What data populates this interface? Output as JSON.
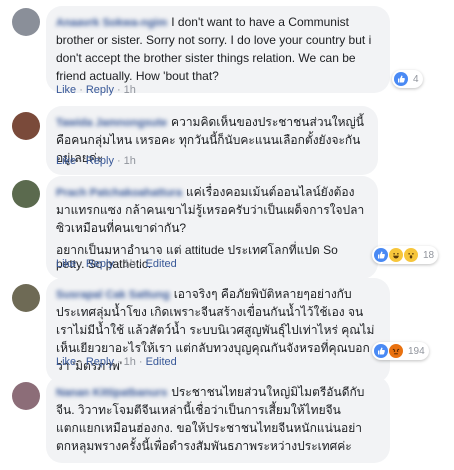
{
  "actions": {
    "like": "Like",
    "reply": "Reply",
    "edited": "Edited"
  },
  "comments": [
    {
      "author": "Anaavrk Sokwa-ngim",
      "text": "I don't want to have a Communist brother or sister. Sorry not sorry. I do love your country but i don't accept the brother sister things relation. We can be friend actually. How 'bout that?",
      "time": "1h",
      "reaction_count": "4",
      "avatar_color": "#8a8f99"
    },
    {
      "author": "Tawida Jamnongsute",
      "text": "ความคิดเห็นของประชาชนส่วนใหญ่นี้คือคนกลุ่มไหน เหรอคะ ทุกวันนี้ก็นับคะแนนเลือกตั้งยังจะกันอยู่เลยค่ะ",
      "time": "1h",
      "avatar_color": "#7a4a3a"
    },
    {
      "author": "Prach Patchakoahattura",
      "text": "แค่เรื่องคอมเม้นต์ออนไลน์ยังต้องมาแทรกแซง กล้าคนเขาไม่รู้เหรอครับว่าเป็นเผด็จการใจปลาซิวเหมือนที่คนเขาด่ากัน?",
      "text2": "อยากเป็นมหาอำนาจ แต่ attitude ประเทศโลกที่แปด So petty. So pathetic.",
      "time": "1h",
      "edited": true,
      "reaction_count": "18",
      "avatar_color": "#5b6a4e"
    },
    {
      "author": "Susrapal Cak Sattung",
      "text": "เอาจริงๆ คือภัยพิบัติหลายๆอย่างกับประเทศลุ่มน้ำโขง เกิดเพราะจีนสร้างเขื่อนกันน้ำไว้ใช้เอง จนเราไม่มีน้ำใช้ แล้วสัตว์น้ำ ระบบนิเวศสูญพันธุ์ไปเท่าไหร่ คุณไม่เห็นเยียวยาอะไรให้เรา แต่กลับทวงบุญคุณกันจังหรอที่คุณบอกว่า 'มิตรภาพ'",
      "time": "1h",
      "edited": true,
      "reaction_count": "194",
      "avatar_color": "#6e6a55"
    },
    {
      "author": "Nanan Kittipatbanurs",
      "text": "ประชาชนไทยส่วนใหญ่มิไมตรีอันดีกับจีน. วิวาทะโจมตีจีนเหล่านี้เชื่อว่าเป็นการเสี้ยมให้ไทยจีนแตกแยกเหมือนฮ่องกง. ขอให้ประชาชนไทยจีนหนักแน่นอย่าตกหลุมพรางครั้งนี้เพื่อดำรงสัมพันธภาพระหว่างประเทศค่ะ",
      "avatar_color": "#8c6d78"
    }
  ]
}
